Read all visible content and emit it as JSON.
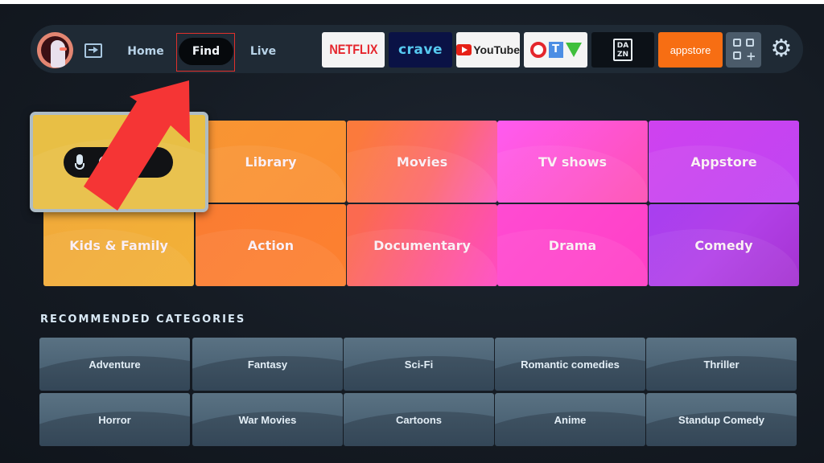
{
  "nav": {
    "avatar": "profile-avatar",
    "input_icon": "input-source-icon",
    "links": [
      {
        "label": "Home",
        "active": false
      },
      {
        "label": "Find",
        "active": true
      },
      {
        "label": "Live",
        "active": false
      }
    ],
    "apps": [
      {
        "label": "NETFLIX",
        "color": "#e5262d"
      },
      {
        "label": "crave",
        "color": "#56c9f0"
      },
      {
        "label": "YouTube",
        "color": "#e62117"
      },
      {
        "label_c": "C",
        "label_t": "T",
        "label_v": "V"
      },
      {
        "label": "DA\nZN"
      },
      {
        "label": "appstore",
        "color": "#f76e13"
      }
    ],
    "apps_grid_icon": "app-library-icon",
    "settings_icon": "gear-icon"
  },
  "annotation": {
    "highlight_color": "#e0302c",
    "arrow_color": "#f53535"
  },
  "main_tiles": {
    "row1": [
      "Library",
      "Movies",
      "TV shows",
      "Appstore"
    ],
    "row2": [
      "Kids & Family",
      "Action",
      "Documentary",
      "Drama",
      "Comedy"
    ]
  },
  "recommended": {
    "title": "RECOMMENDED CATEGORIES",
    "row1": [
      "Adventure",
      "Fantasy",
      "Sci-Fi",
      "Romantic comedies",
      "Thriller"
    ],
    "row2": [
      "Horror",
      "War Movies",
      "Cartoons",
      "Anime",
      "Standup Comedy"
    ]
  }
}
